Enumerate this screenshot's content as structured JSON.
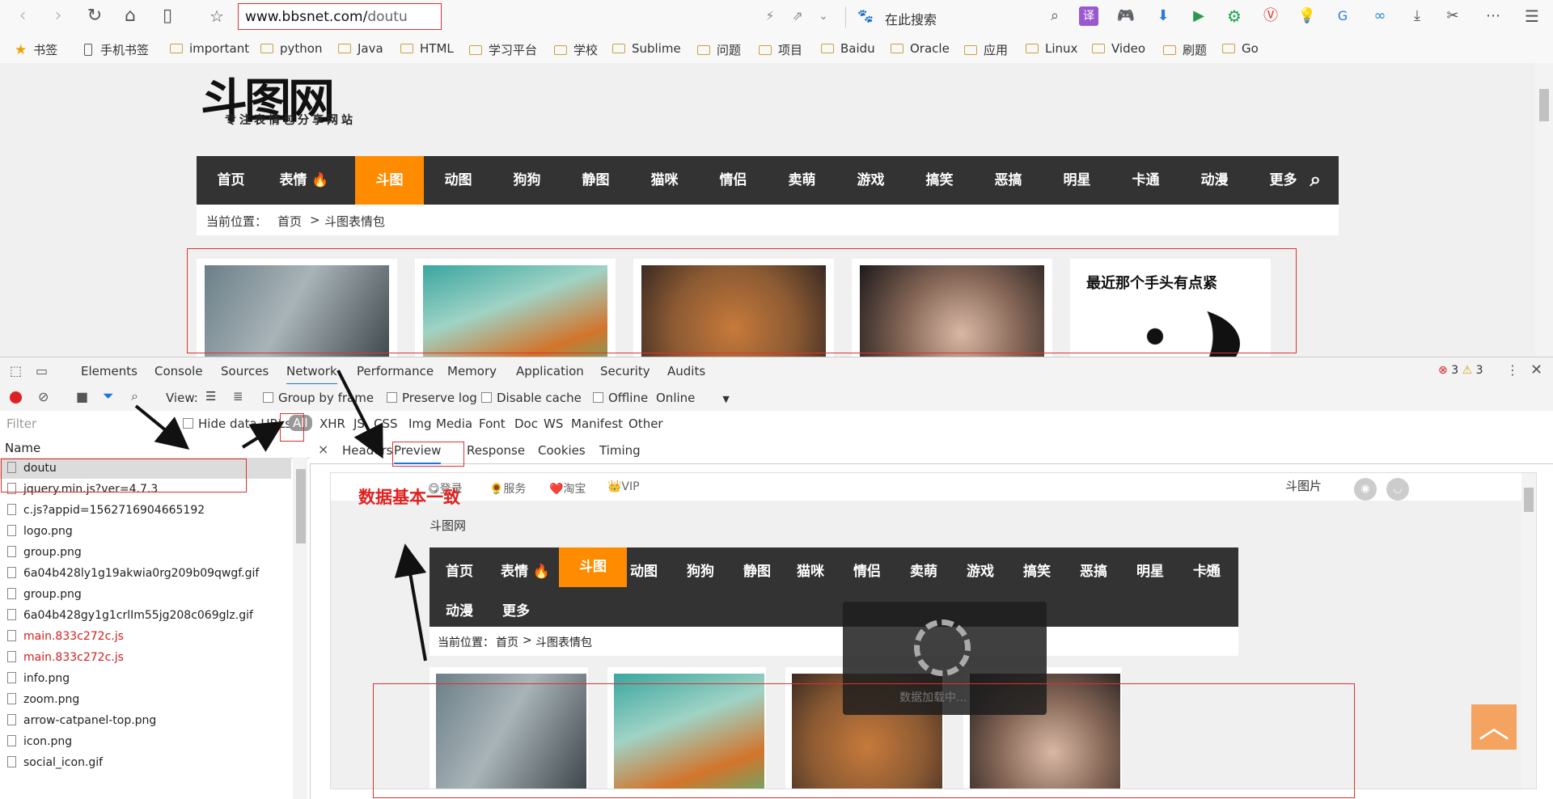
{
  "browser": {
    "nav_icons": [
      "back-arrow-icon",
      "forward-arrow-icon",
      "reload-icon",
      "home-icon",
      "reading-icon",
      "star-icon"
    ],
    "url_host": "www.bbsnet.com/",
    "url_path": "doutu",
    "search_placeholder": "在此搜索",
    "menu_icon": "⋯",
    "menu_glyph": "☰"
  },
  "bookmarks": {
    "items": [
      "书签",
      "手机书签",
      "important",
      "python",
      "Java",
      "HTML",
      "学习平台",
      "学校",
      "Sublime",
      "问题",
      "项目",
      "Baidu",
      "Oracle",
      "应用",
      "Linux",
      "Video",
      "刷题",
      "Go"
    ]
  },
  "site": {
    "logo_main": "斗图网",
    "logo_sub": "专注表情包分享网站",
    "nav": [
      "首页",
      "表情 🔥",
      "斗图",
      "动图",
      "狗狗",
      "静图",
      "猫咪",
      "情侣",
      "卖萌",
      "游戏",
      "搞笑",
      "恶搞",
      "明星",
      "卡通",
      "动漫",
      "更多"
    ],
    "active_nav": "斗图",
    "crumb_label": "当前位置：",
    "crumb_home": "首页",
    "crumb_sep": ">",
    "crumb_current": "斗图表情包",
    "card5_text": "最近那个手头有点紧"
  },
  "devtools": {
    "tabs": [
      "Elements",
      "Console",
      "Sources",
      "Network",
      "Performance",
      "Memory",
      "Application",
      "Security",
      "Audits"
    ],
    "active_tab": "Network",
    "errors": "3",
    "warnings": "3",
    "view_label": "View:",
    "group_by_frame": "Group by frame",
    "preserve_log": "Preserve log",
    "disable_cache": "Disable cache",
    "offline": "Offline",
    "throttle": "Online",
    "filter_placeholder": "Filter",
    "hide_data_urls": "Hide data URLs",
    "types": [
      "All",
      "XHR",
      "JS",
      "CSS",
      "Img",
      "Media",
      "Font",
      "Doc",
      "WS",
      "Manifest",
      "Other"
    ],
    "name_header": "Name",
    "requests": [
      {
        "name": "doutu",
        "red": false
      },
      {
        "name": "jquery.min.js?ver=4.7.3",
        "red": false
      },
      {
        "name": "c.js?appid=1562716904665192",
        "red": false
      },
      {
        "name": "logo.png",
        "red": false
      },
      {
        "name": "group.png",
        "red": false
      },
      {
        "name": "6a04b428ly1g19akwia0rg209b09qwgf.gif",
        "red": false
      },
      {
        "name": "group.png",
        "red": false
      },
      {
        "name": "6a04b428gy1g1crlIm55jg208c069glz.gif",
        "red": false
      },
      {
        "name": "main.833c272c.js",
        "red": true
      },
      {
        "name": "main.833c272c.js",
        "red": true
      },
      {
        "name": "info.png",
        "red": false
      },
      {
        "name": "zoom.png",
        "red": false
      },
      {
        "name": "arrow-catpanel-top.png",
        "red": false
      },
      {
        "name": "icon.png",
        "red": false
      },
      {
        "name": "social_icon.gif",
        "red": false
      }
    ],
    "subtabs": [
      "Headers",
      "Preview",
      "Response",
      "Cookies",
      "Timing"
    ],
    "active_subtab": "Preview"
  },
  "preview": {
    "top_links": [
      "😋登录",
      "🌻服务",
      "❤️淘宝",
      "👑VIP"
    ],
    "broken_img": "斗图片",
    "logo_alt": "斗图网",
    "nav_row1": [
      "首页",
      "表情 🔥",
      "斗图",
      "动图",
      "狗狗",
      "静图",
      "猫咪",
      "情侣",
      "卖萌",
      "游戏",
      "搞笑",
      "恶搞",
      "明星",
      "卡通"
    ],
    "nav_row2": [
      "动漫",
      "更多"
    ],
    "crumb_label": "当前位置：",
    "crumb_home": "首页",
    "crumb_sep": ">",
    "crumb_current": "斗图表情包",
    "loading_text": "数据加载中...",
    "backtop": "︿"
  },
  "annotation": {
    "note": "数据基本一致"
  }
}
